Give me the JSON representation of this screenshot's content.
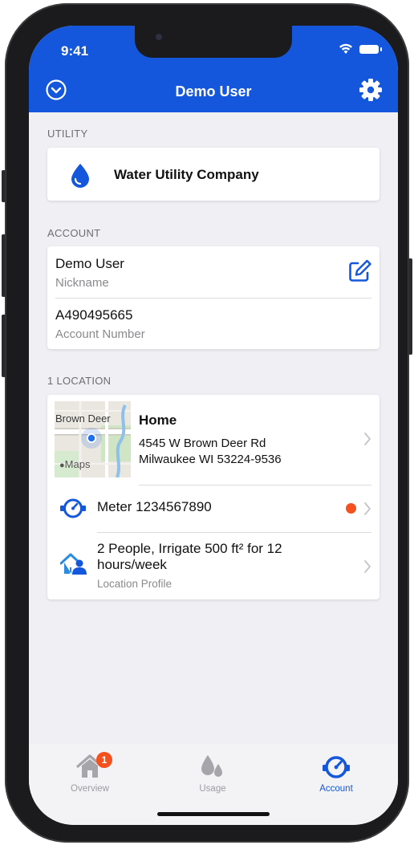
{
  "status_bar": {
    "time": "9:41"
  },
  "header": {
    "title": "Demo User",
    "left_icon": "chevron-down-circle-icon",
    "right_icon": "gear-icon"
  },
  "utility": {
    "section_label": "UTILITY",
    "name": "Water Utility Company",
    "icon": "water-drop-icon"
  },
  "account": {
    "section_label": "ACCOUNT",
    "nickname_value": "Demo User",
    "nickname_label": "Nickname",
    "number_value": "A490495665",
    "number_label": "Account Number",
    "edit_icon": "edit-icon"
  },
  "locations": {
    "section_label": "1 LOCATION",
    "map_label": "Brown Deer",
    "map_attribution": "Maps",
    "title": "Home",
    "address_line1": "4545 W Brown Deer Rd",
    "address_line2": "Milwaukee WI 53224-9536",
    "meter_label": "Meter 1234567890",
    "meter_alert": true,
    "profile_text": "2 People, Irrigate 500 ft² for 12 hours/week",
    "profile_sub": "Location Profile"
  },
  "tabbar": {
    "tabs": [
      {
        "label": "Overview",
        "icon": "home-icon",
        "badge": "1"
      },
      {
        "label": "Usage",
        "icon": "drops-icon"
      },
      {
        "label": "Account",
        "icon": "meter-icon",
        "active": true
      }
    ]
  },
  "colors": {
    "primary": "#1557dc",
    "alert": "#f4511e",
    "background": "#efeff4"
  }
}
